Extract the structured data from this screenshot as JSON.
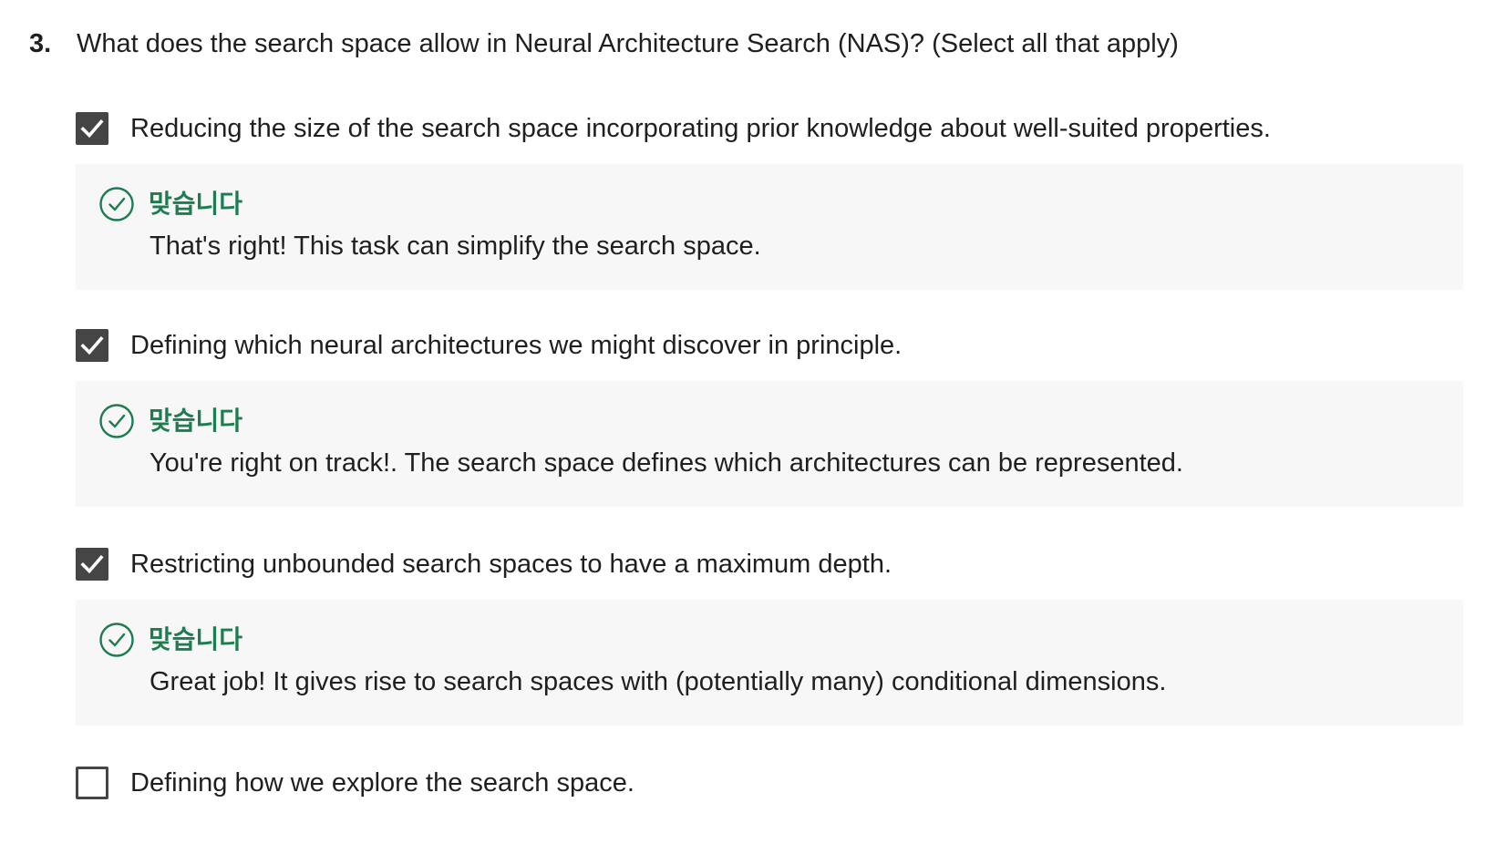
{
  "question": {
    "number": "3.",
    "text": "What does the search space allow in Neural Architecture Search (NAS)? (Select all that apply)"
  },
  "options": [
    {
      "label": "Reducing the size of the search space incorporating prior knowledge about well-suited properties.",
      "checked": true,
      "feedback": {
        "status": "맞습니다",
        "text": "That's right! This task can simplify the search space."
      }
    },
    {
      "label": "Defining which neural architectures we might discover in principle.",
      "checked": true,
      "feedback": {
        "status": "맞습니다",
        "text": "You're right on track!. The search space defines which architectures can be represented."
      }
    },
    {
      "label": "Restricting unbounded search spaces to have a maximum depth.",
      "checked": true,
      "feedback": {
        "status": "맞습니다",
        "text": "Great job! It gives rise to search spaces with (potentially many) conditional dimensions."
      }
    },
    {
      "label": "Defining how we explore the search space.",
      "checked": false
    }
  ],
  "colors": {
    "checkbox": "#454545",
    "correct": "#1d7c50",
    "feedback_bg": "#f6f7f6",
    "text": "#1f1f1f"
  },
  "icons": {
    "checkbox_checked": "checkmark-icon",
    "feedback_correct": "check-circle-icon"
  }
}
